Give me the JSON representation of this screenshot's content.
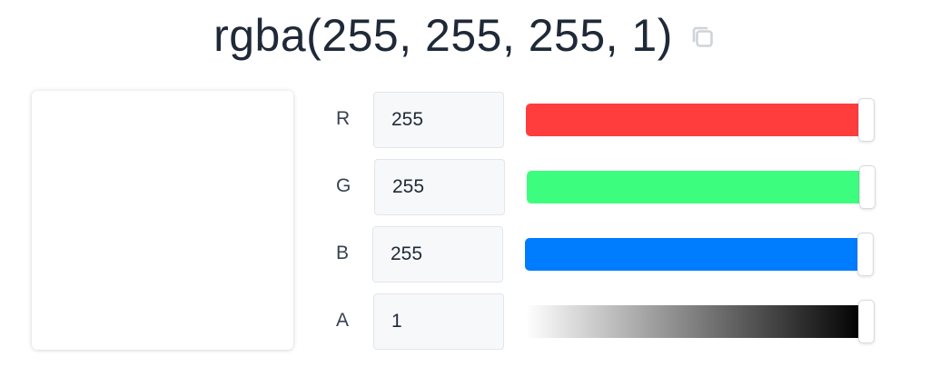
{
  "header": {
    "title": "rgba(255, 255, 255, 1)"
  },
  "icons": {
    "copy": "copy-icon"
  },
  "preview": {
    "color": "#ffffff"
  },
  "channels": [
    {
      "label": "R",
      "value": "255",
      "level": 1.0,
      "color": "#ff3d3d"
    },
    {
      "label": "G",
      "value": "255",
      "level": 1.0,
      "color": "#3dfd7e"
    },
    {
      "label": "B",
      "value": "255",
      "level": 1.0,
      "color": "#007cff"
    },
    {
      "label": "A",
      "value": "1",
      "level": 1.0,
      "color": "#000000"
    }
  ]
}
